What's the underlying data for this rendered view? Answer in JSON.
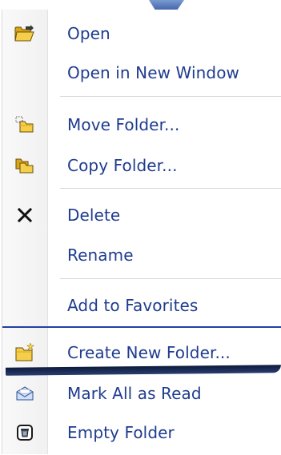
{
  "context_menu": {
    "items": [
      {
        "label": "Open",
        "icon": "folder-open-icon"
      },
      {
        "label": "Open in New Window",
        "icon": ""
      },
      {
        "label": "Move Folder...",
        "icon": "move-folder-icon"
      },
      {
        "label": "Copy Folder...",
        "icon": "copy-folder-icon"
      },
      {
        "label": "Delete",
        "icon": "delete-x-icon"
      },
      {
        "label": "Rename",
        "icon": ""
      },
      {
        "label": "Add to Favorites",
        "icon": ""
      },
      {
        "label": "Create New Folder...",
        "icon": "new-folder-icon"
      },
      {
        "label": "Mark All as Read",
        "icon": "mark-read-envelope-icon"
      },
      {
        "label": "Empty Folder",
        "icon": "empty-folder-bin-icon"
      }
    ]
  },
  "colors": {
    "label_text": "#1f3c8f",
    "accent_separator": "#233fa5",
    "folder_yellow": "#f4c842"
  }
}
